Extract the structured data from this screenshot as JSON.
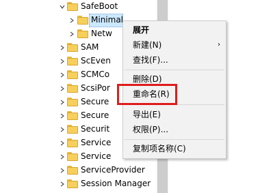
{
  "tree": {
    "parent": "SafeBoot",
    "children": [
      "Minimal",
      "Network"
    ],
    "child_visible_text": [
      "Minimal",
      "Netw"
    ],
    "siblings_visible_text": [
      "SAM",
      "ScEven",
      "SCMCo",
      "ScsiPor",
      "Secure",
      "Secure",
      "Securit",
      "Service",
      "Service",
      "ServiceProvider",
      "Session Manager"
    ]
  },
  "context_menu": {
    "items": [
      {
        "label": "展开",
        "bold": true
      },
      {
        "label": "新建(N)",
        "submenu": true
      },
      {
        "label": "查找(F)..."
      },
      {
        "label": "删除(D)"
      },
      {
        "label": "重命名(R)"
      },
      {
        "label": "导出(E)"
      },
      {
        "label": "权限(P)..."
      },
      {
        "label": "复制项名称(C)"
      }
    ],
    "submenu_arrow": "›"
  },
  "colors": {
    "highlight": "#e01b1b",
    "selection": "#cce8ff",
    "folder": "#f7cf5b"
  }
}
